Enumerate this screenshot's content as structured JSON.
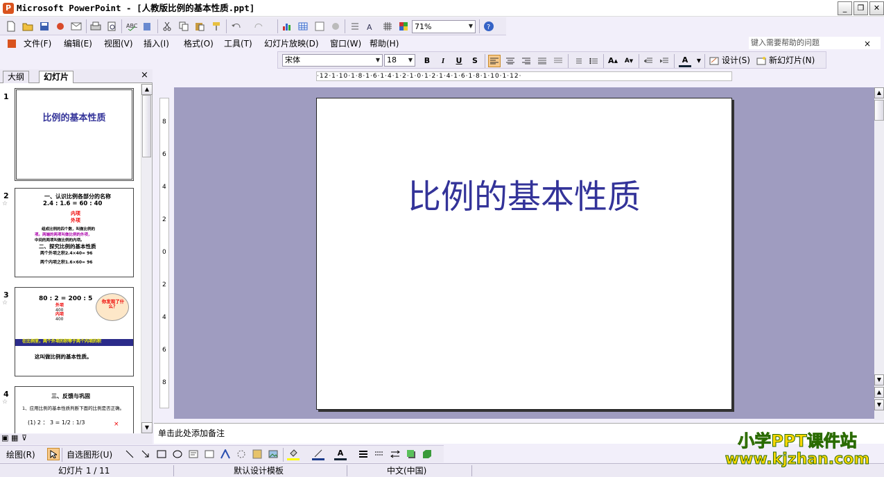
{
  "window": {
    "title": "Microsoft PowerPoint - [人教版比例的基本性质.ppt]",
    "minimize": "_",
    "restore": "❐",
    "close": "✕"
  },
  "toolbar": {
    "zoom": "71%"
  },
  "menu": {
    "items": [
      "文件(F)",
      "编辑(E)",
      "视图(V)",
      "插入(I)",
      "格式(O)",
      "工具(T)",
      "幻灯片放映(D)",
      "窗口(W)",
      "帮助(H)"
    ],
    "help_placeholder": "键入需要帮助的问题",
    "help_close": "×"
  },
  "format": {
    "font": "宋体",
    "size": "18",
    "bold": "B",
    "italic": "I",
    "underline": "U",
    "shadow": "S",
    "design": "设计(S)",
    "new_slide": "新幻灯片(N)"
  },
  "panel": {
    "tabs": [
      "大纲",
      "幻灯片"
    ],
    "close": "×"
  },
  "thumbs": [
    {
      "num": "1",
      "title": "比例的基本性质"
    },
    {
      "num": "2",
      "lines": [
        "一、认识比例各部分的名称",
        "2.4 : 1.6 = 60 : 40",
        "内项",
        "外项",
        "组成比例的四个数，叫做比例的",
        "项。两端的两项叫做比例的外项，",
        "中间的两项叫做比例的内项。",
        "二、探究比例的基本性质",
        "两个外项之积2.4×40= 96",
        "两个内项之积1.6×60= 96"
      ]
    },
    {
      "num": "3",
      "lines": [
        "80 : 2 = 200 : 5",
        "外项",
        "400",
        "内项",
        "400",
        "你发现了什么？",
        "在比例里，两个外项的积等于两个内项的积",
        "这叫做比例的基本性质。"
      ]
    },
    {
      "num": "4",
      "lines": [
        "三、反馈与巩固",
        "1、应用比例的基本性质判断下面的比例是否正确。",
        "(1) 2 ： 3 = 1/2 : 1/3",
        "×"
      ]
    }
  ],
  "slide": {
    "title": "比例的基本性质"
  },
  "ruler": {
    "h": "·12·1·10·1·8·1·6·1·4·1·2·1·0·1·2·1·4·1·6·1·8·1·10·1·12·",
    "v": [
      "8",
      "6",
      "4",
      "2",
      "0",
      "2",
      "4",
      "6",
      "8"
    ]
  },
  "notes": {
    "placeholder": "单击此处添加备注"
  },
  "drawbar": {
    "draw": "绘图(R)",
    "autoshapes": "自选图形(U)"
  },
  "status": {
    "slide": "幻灯片 1 / 11",
    "template": "默认设计模板",
    "language": "中文(中国)"
  },
  "watermark": {
    "line1": "小学PPT课件站",
    "line2": "www.kjzhan.com"
  }
}
